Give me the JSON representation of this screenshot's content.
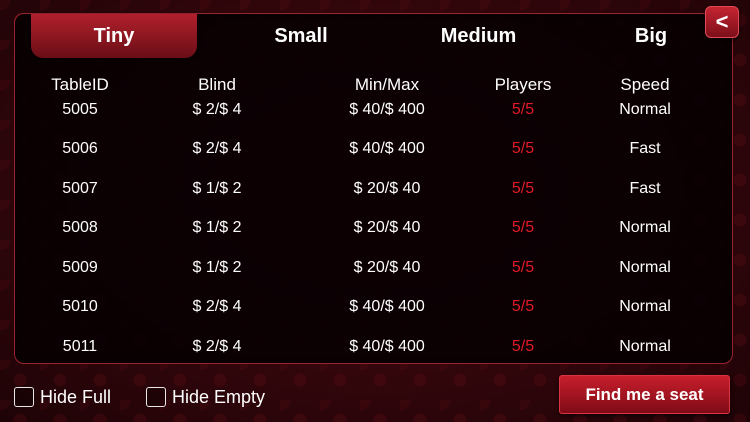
{
  "tabs": [
    "Tiny",
    "Small",
    "Medium",
    "Big"
  ],
  "active_tab": "Tiny",
  "back_button": "<",
  "headers": {
    "table_id": "TableID",
    "blind": "Blind",
    "min_max": "Min/Max",
    "players": "Players",
    "speed": "Speed"
  },
  "rows": [
    {
      "table_id": "5005",
      "blind": "$ 2/$ 4",
      "min_max": "$ 40/$ 400",
      "players": "5/5",
      "speed": "Normal"
    },
    {
      "table_id": "5006",
      "blind": "$ 2/$ 4",
      "min_max": "$ 40/$ 400",
      "players": "5/5",
      "speed": "Fast"
    },
    {
      "table_id": "5007",
      "blind": "$ 1/$ 2",
      "min_max": "$ 20/$ 40",
      "players": "5/5",
      "speed": "Fast"
    },
    {
      "table_id": "5008",
      "blind": "$ 1/$ 2",
      "min_max": "$ 20/$ 40",
      "players": "5/5",
      "speed": "Normal"
    },
    {
      "table_id": "5009",
      "blind": "$ 1/$ 2",
      "min_max": "$ 20/$ 40",
      "players": "5/5",
      "speed": "Normal"
    },
    {
      "table_id": "5010",
      "blind": "$ 2/$ 4",
      "min_max": "$ 40/$ 400",
      "players": "5/5",
      "speed": "Normal"
    },
    {
      "table_id": "5011",
      "blind": "$ 2/$ 4",
      "min_max": "$ 40/$ 400",
      "players": "5/5",
      "speed": "Normal"
    }
  ],
  "filters": {
    "hide_full": "Hide Full",
    "hide_empty": "Hide Empty"
  },
  "find_seat_button": "Find me a seat",
  "colors": {
    "accent_red": "#c81e2c",
    "players_red": "#e11a26",
    "panel_border": "#9a2330"
  }
}
